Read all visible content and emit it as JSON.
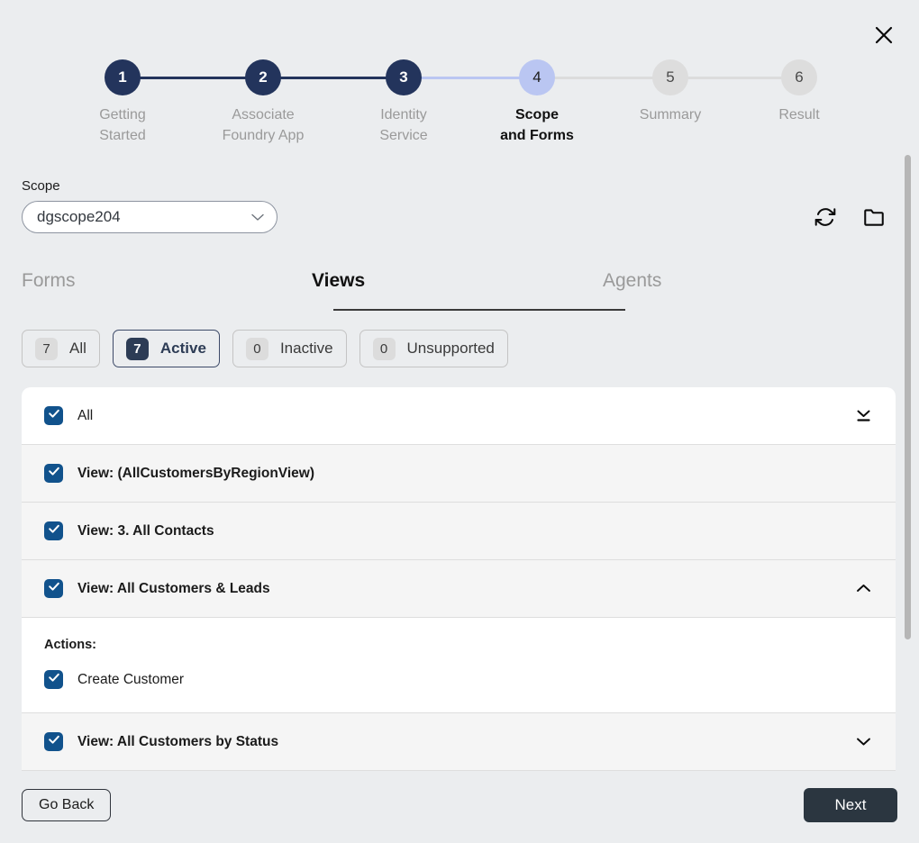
{
  "dialog": {
    "close_icon": "close-icon"
  },
  "stepper": {
    "steps": [
      {
        "number": "1",
        "label": "Getting\nStarted",
        "state": "done"
      },
      {
        "number": "2",
        "label": "Associate\nFoundry App",
        "state": "done"
      },
      {
        "number": "3",
        "label": "Identity\nService",
        "state": "done"
      },
      {
        "number": "4",
        "label": "Scope\nand Forms",
        "state": "current"
      },
      {
        "number": "5",
        "label": "Summary",
        "state": "todo"
      },
      {
        "number": "6",
        "label": "Result",
        "state": "todo"
      }
    ],
    "colors": {
      "done": "#23345c",
      "current": "#bac6f2",
      "todo": "#dddddd"
    }
  },
  "scope": {
    "label": "Scope",
    "selected": "dgscope204",
    "caret_icon": "chevron-down-icon",
    "refresh_icon": "refresh-icon",
    "folder_icon": "folder-icon"
  },
  "tabs": [
    {
      "label": "Forms",
      "active": false
    },
    {
      "label": "Views",
      "active": true
    },
    {
      "label": "Agents",
      "active": false
    }
  ],
  "filters": [
    {
      "count": "7",
      "label": "All",
      "selected": false
    },
    {
      "count": "7",
      "label": "Active",
      "selected": true
    },
    {
      "count": "0",
      "label": "Inactive",
      "selected": false
    },
    {
      "count": "0",
      "label": "Unsupported",
      "selected": false
    }
  ],
  "list": {
    "select_all": {
      "label": "All",
      "checked": true,
      "collapse_icon": "collapse-all-icon"
    },
    "rows": [
      {
        "label": "View: (AllCustomersByRegionView)",
        "checked": true,
        "expanded": false,
        "chevron": "none"
      },
      {
        "label": "View: 3. All Contacts",
        "checked": true,
        "expanded": false,
        "chevron": "none"
      },
      {
        "label": "View: All Customers & Leads",
        "checked": true,
        "expanded": true,
        "chevron": "chevron-up-icon",
        "panel": {
          "title": "Actions:",
          "items": [
            {
              "label": "Create Customer",
              "checked": true
            }
          ]
        }
      },
      {
        "label": "View: All Customers by Status",
        "checked": true,
        "expanded": false,
        "chevron": "chevron-down-icon"
      }
    ],
    "checkbox_color": "#11528c"
  },
  "footer": {
    "back_label": "Go Back",
    "next_label": "Next",
    "next_color": "#2b3640"
  }
}
